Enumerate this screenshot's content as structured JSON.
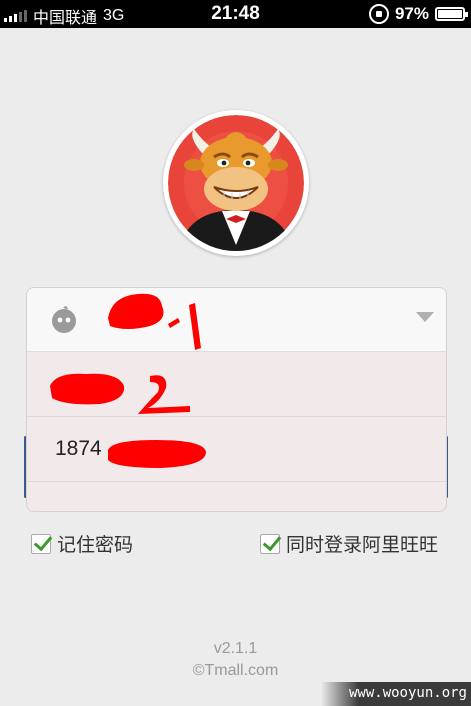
{
  "status_bar": {
    "carrier": "中国联通",
    "network": "3G",
    "time": "21:48",
    "battery": "97%"
  },
  "login_form": {
    "account_number_prefix": "1874"
  },
  "options": {
    "remember_password": "记住密码",
    "remember_checked": true,
    "login_wangwang": "同时登录阿里旺旺",
    "wangwang_checked": true
  },
  "footer": {
    "version": "v2.1.1",
    "copyright": "©Tmall.com"
  },
  "watermark": "www.wooyun.org",
  "icons": {
    "avatar": "cartoon-bull-mascot",
    "user": "user-face-icon",
    "dropdown": "triangle-down-icon",
    "checkbox": "checkmark-icon"
  },
  "colors": {
    "scribble": "#ff0000",
    "check": "#3a9a2a",
    "avatar_bg": "#e9443a"
  }
}
